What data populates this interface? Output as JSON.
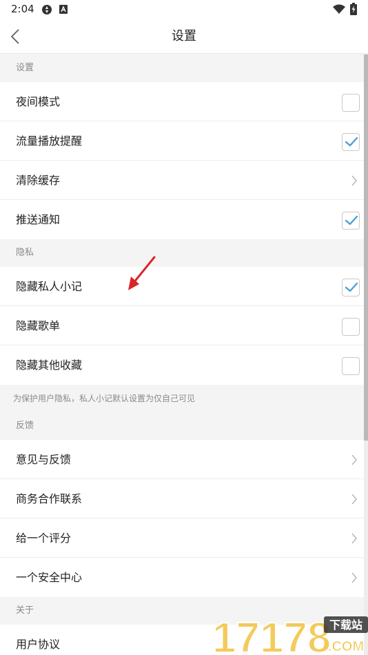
{
  "status_bar": {
    "time": "2:04",
    "icons": [
      "sync-icon",
      "a-icon",
      "wifi-icon",
      "battery-charging-icon"
    ]
  },
  "title_bar": {
    "back_icon": "chevron-left-icon",
    "title": "设置"
  },
  "sections": {
    "settings": {
      "header": "设置",
      "items": [
        {
          "label": "夜间模式",
          "control": "checkbox",
          "checked": false
        },
        {
          "label": "流量播放提醒",
          "control": "checkbox",
          "checked": true
        },
        {
          "label": "清除缓存",
          "control": "chevron"
        },
        {
          "label": "推送通知",
          "control": "checkbox",
          "checked": true
        }
      ]
    },
    "privacy": {
      "header": "隐私",
      "items": [
        {
          "label": "隐藏私人小记",
          "control": "checkbox",
          "checked": true
        },
        {
          "label": "隐藏歌单",
          "control": "checkbox",
          "checked": false
        },
        {
          "label": "隐藏其他收藏",
          "control": "checkbox",
          "checked": false
        }
      ],
      "note": "为保护用户隐私，私人小记默认设置为仅自己可见"
    },
    "feedback": {
      "header": "反馈",
      "items": [
        {
          "label": "意见与反馈",
          "control": "chevron"
        },
        {
          "label": "商务合作联系",
          "control": "chevron"
        },
        {
          "label": "给一个评分",
          "control": "chevron"
        },
        {
          "label": "一个安全中心",
          "control": "chevron"
        }
      ]
    },
    "about": {
      "header": "关于",
      "items": [
        {
          "label": "用户协议",
          "control": "none"
        }
      ]
    }
  },
  "colors": {
    "checkmark": "#4a9fd8",
    "annotation_arrow": "#d9252a",
    "background": "#f4f4f4"
  },
  "watermark": {
    "number": "17178",
    "badge": "下载站",
    "domain": ".COM"
  }
}
